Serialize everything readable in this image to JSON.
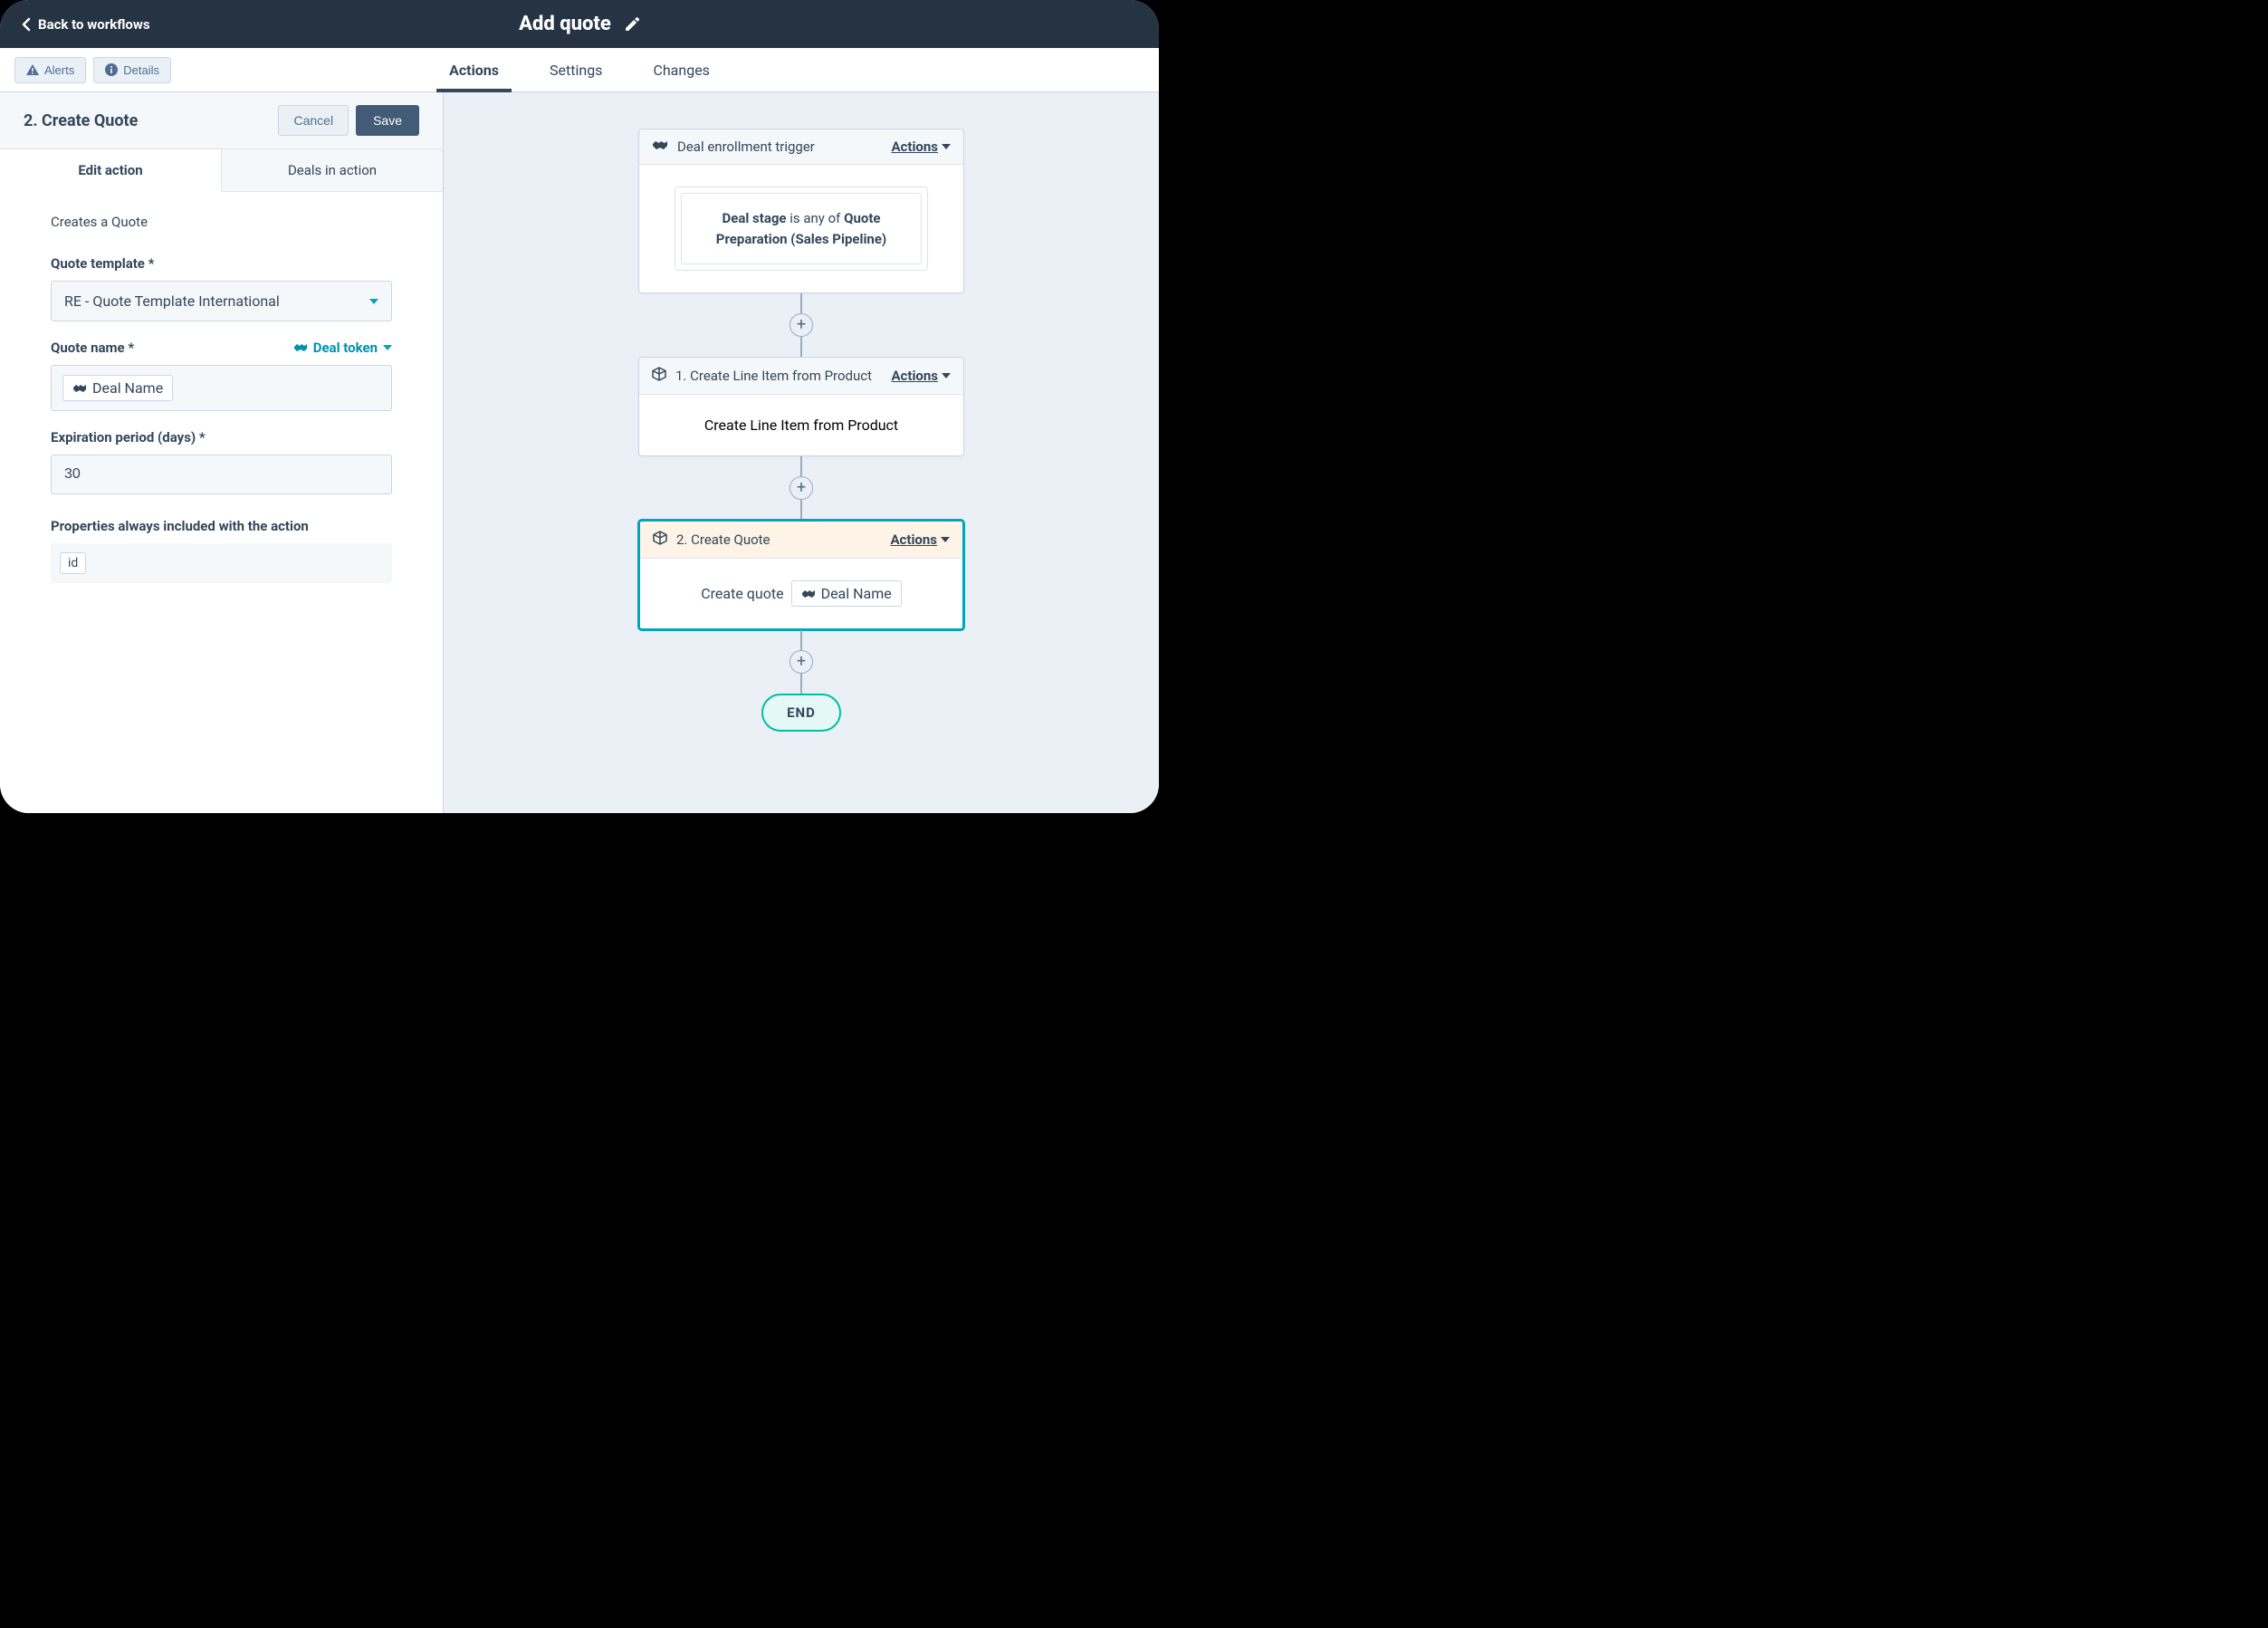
{
  "header": {
    "back_label": "Back to workflows",
    "title": "Add quote"
  },
  "subnav": {
    "alerts": "Alerts",
    "details": "Details",
    "tabs": {
      "actions": "Actions",
      "settings": "Settings",
      "changes": "Changes"
    }
  },
  "panel": {
    "title": "2. Create Quote",
    "cancel": "Cancel",
    "save": "Save",
    "tabs": {
      "edit": "Edit action",
      "deals": "Deals in action"
    },
    "description": "Creates a Quote",
    "quote_template_label": "Quote template *",
    "quote_template_value": "RE - Quote Template International",
    "quote_name_label": "Quote name *",
    "deal_token_link": "Deal token",
    "quote_name_pill": "Deal Name",
    "expiration_label": "Expiration period (days) *",
    "expiration_value": "30",
    "props_label": "Properties always included with the action",
    "props_chip": "id"
  },
  "canvas": {
    "trigger": {
      "header": "Deal enrollment trigger",
      "actions": "Actions",
      "prop": "Deal stage",
      "middle": " is any of ",
      "value": "Quote Preparation (Sales Pipeline)"
    },
    "node1": {
      "header": "1. Create Line Item from Product",
      "actions": "Actions",
      "body": "Create Line Item from Product"
    },
    "node2": {
      "header": "2. Create Quote",
      "actions": "Actions",
      "body_prefix": "Create quote",
      "pill": "Deal Name"
    },
    "end": "END"
  }
}
